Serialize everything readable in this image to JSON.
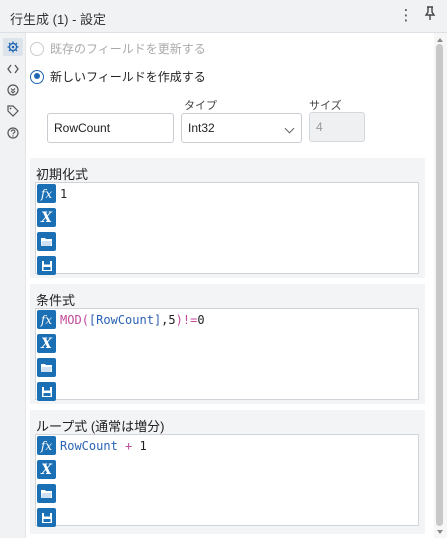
{
  "header": {
    "title": "行生成 (1) - 設定",
    "menu_glyph": "⋮",
    "pin_glyph": "📌"
  },
  "side_rail": {
    "items": [
      {
        "icon": "gear-icon"
      },
      {
        "icon": "code-brackets-icon"
      },
      {
        "icon": "metadata-icon"
      },
      {
        "icon": "tag-icon"
      },
      {
        "icon": "help-icon"
      }
    ]
  },
  "options": {
    "update_existing": {
      "label": "既存のフィールドを更新する",
      "selected": false,
      "enabled": false
    },
    "create_new": {
      "label": "新しいフィールドを作成する",
      "selected": true
    }
  },
  "new_field": {
    "name_value": "RowCount",
    "type_label": "タイプ",
    "type_value": "Int32",
    "size_label": "サイズ",
    "size_value": "4"
  },
  "expressions": {
    "init": {
      "title": "初期化式",
      "tokens": [
        {
          "t": "1",
          "k": "num"
        }
      ]
    },
    "condition": {
      "title": "条件式",
      "tokens": [
        {
          "t": "MOD",
          "k": "fn"
        },
        {
          "t": "(",
          "k": "fn"
        },
        {
          "t": "[RowCount]",
          "k": "field"
        },
        {
          "t": ",5",
          "k": "num"
        },
        {
          "t": ")",
          "k": "fn"
        },
        {
          "t": "!=",
          "k": "op"
        },
        {
          "t": "0",
          "k": "num"
        }
      ]
    },
    "loop": {
      "title": "ループ式 (通常は増分)",
      "tokens": [
        {
          "t": "RowCount",
          "k": "field"
        },
        {
          "t": " + ",
          "k": "op"
        },
        {
          "t": "1",
          "k": "num"
        }
      ]
    }
  },
  "tools": {
    "fx": "fx",
    "x": "X"
  },
  "colors": {
    "accent": "#1a6fb5",
    "radio": "#1f66b3"
  }
}
